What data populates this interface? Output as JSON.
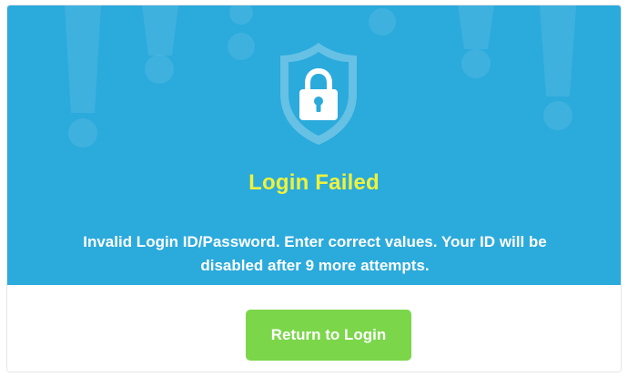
{
  "dialog": {
    "title": "Login Failed",
    "message_line1": "Invalid Login ID/Password. Enter correct values. Your ID will be",
    "message_line2": "disabled after 9 more attempts.",
    "return_button_label": "Return to Login"
  },
  "icons": {
    "main": "shield-lock-icon",
    "background": "exclamation-mark-icon"
  },
  "colors": {
    "banner": "#2baadc",
    "title": "#eef23c",
    "message": "#ffffff",
    "button": "#7bd64a"
  }
}
